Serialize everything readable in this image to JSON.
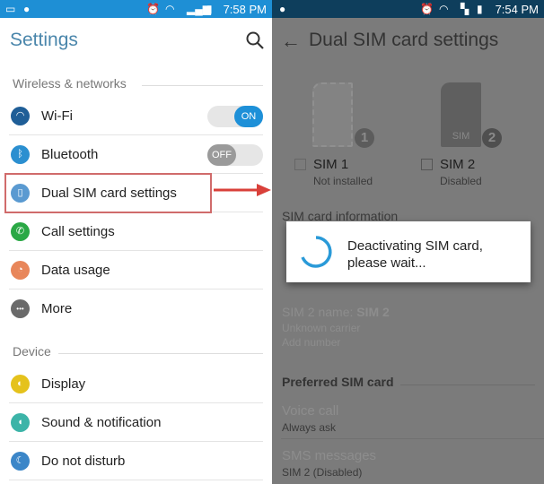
{
  "left": {
    "status_bar": {
      "time": "7:58 PM",
      "color": "#1e8fd5"
    },
    "title": "Settings",
    "search_icon": "search-icon",
    "sections": [
      {
        "header": "Wireless & networks",
        "items": [
          {
            "label": "Wi-Fi",
            "icon": "wifi-icon",
            "color": "#1f5e97",
            "toggle": "ON"
          },
          {
            "label": "Bluetooth",
            "icon": "bluetooth-icon",
            "color": "#2b8fd0",
            "toggle": "OFF"
          },
          {
            "label": "Dual SIM card settings",
            "icon": "sim-icon",
            "color": "#5a9ad1",
            "highlighted": true
          },
          {
            "label": "Call settings",
            "icon": "phone-icon",
            "color": "#2aa845"
          },
          {
            "label": "Data usage",
            "icon": "data-usage-icon",
            "color": "#e8865a"
          },
          {
            "label": "More",
            "icon": "more-icon",
            "color": "#6a6a6a"
          }
        ]
      },
      {
        "header": "Device",
        "items": [
          {
            "label": "Display",
            "icon": "display-icon",
            "color": "#e5c21c"
          },
          {
            "label": "Sound & notification",
            "icon": "sound-icon",
            "color": "#3cb4a8"
          },
          {
            "label": "Do not disturb",
            "icon": "moon-icon",
            "color": "#3b86c8"
          }
        ]
      }
    ]
  },
  "arrow_color": "#d9403a",
  "right": {
    "status_bar": {
      "time": "7:54 PM",
      "color": "#0e3e5c"
    },
    "title": "Dual SIM card settings",
    "sims": [
      {
        "name": "SIM 1",
        "status": "Not installed",
        "badge": "1"
      },
      {
        "name": "SIM 2",
        "status": "Disabled",
        "badge": "2",
        "card_label": "SIM"
      }
    ],
    "sim_info_header": "SIM card information",
    "sim2_name_label": "SIM 2 name:",
    "sim2_name_value": "SIM 2",
    "sim2_carrier": "Unknown carrier",
    "sim2_number": "Add number",
    "preferred_header": "Preferred SIM card",
    "voice_call": {
      "label": "Voice call",
      "value": "Always ask"
    },
    "sms": {
      "label": "SMS messages",
      "value": "SIM 2 (Disabled)"
    },
    "dialog": {
      "line1": "Deactivating SIM card,",
      "line2": "please wait...",
      "spinner_color": "#2a9ad8"
    }
  }
}
